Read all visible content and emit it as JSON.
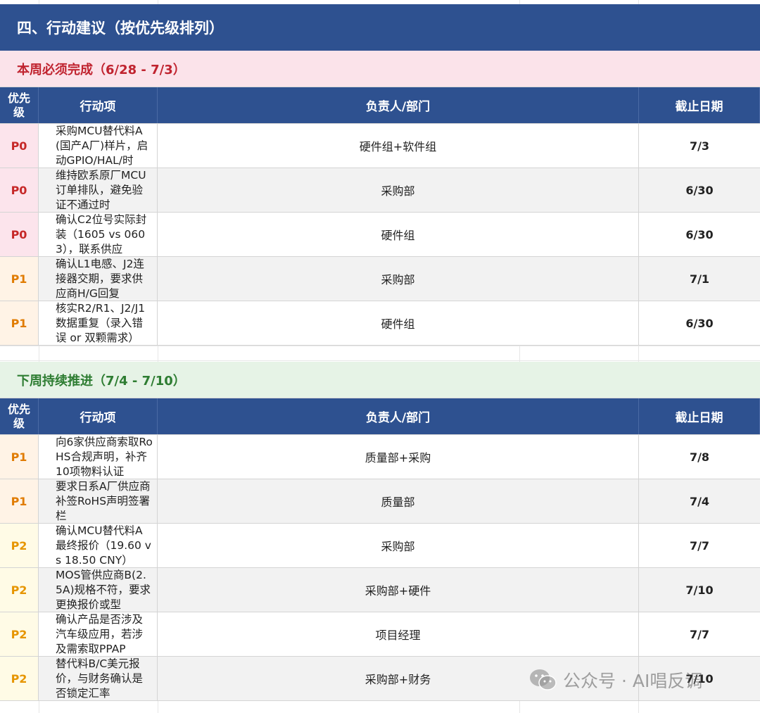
{
  "section": {
    "title": "四、行动建议（按优先级排列）"
  },
  "table_headers": {
    "priority": "优先级",
    "action": "行动项",
    "owner": "负责人/部门",
    "due": "截止日期"
  },
  "week1": {
    "title": "本周必须完成（6/28 - 7/3）",
    "rows": [
      {
        "priority": "P0",
        "action": "采购MCU替代料A(国产A厂)样片，启动GPIO/HAL/时",
        "owner": "硬件组+软件组",
        "due": "7/3"
      },
      {
        "priority": "P0",
        "action": "维持欧系原厂MCU订单排队，避免验证不通过时",
        "owner": "采购部",
        "due": "6/30"
      },
      {
        "priority": "P0",
        "action": "确认C2位号实际封装（1605 vs 0603），联系供应",
        "owner": "硬件组",
        "due": "6/30"
      },
      {
        "priority": "P1",
        "action": "确认L1电感、J2连接器交期，要求供应商H/G回复",
        "owner": "采购部",
        "due": "7/1"
      },
      {
        "priority": "P1",
        "action": "核实R2/R1、J2/J1数据重复（录入错误 or 双颗需求）",
        "owner": "硬件组",
        "due": "6/30"
      }
    ]
  },
  "week2": {
    "title": "下周持续推进（7/4 - 7/10）",
    "rows": [
      {
        "priority": "P1",
        "action": "向6家供应商索取RoHS合规声明，补齐10项物料认证",
        "owner": "质量部+采购",
        "due": "7/8"
      },
      {
        "priority": "P1",
        "action": "要求日系A厂供应商补签RoHS声明签署栏",
        "owner": "质量部",
        "due": "7/4"
      },
      {
        "priority": "P2",
        "action": "确认MCU替代料A最终报价（19.60 vs 18.50 CNY）",
        "owner": "采购部",
        "due": "7/7"
      },
      {
        "priority": "P2",
        "action": "MOS管供应商B(2.5A)规格不符，要求更换报价或型",
        "owner": "采购部+硬件",
        "due": "7/10"
      },
      {
        "priority": "P2",
        "action": "确认产品是否涉及汽车级应用，若涉及需索取PPAP",
        "owner": "项目经理",
        "due": "7/7"
      },
      {
        "priority": "P2",
        "action": "替代料B/C美元报价，与财务确认是否锁定汇率",
        "owner": "采购部+财务",
        "due": "7/10"
      }
    ]
  },
  "watermark": {
    "text": "公众号 · AI唱反调",
    "icon": "wechat-icon"
  },
  "colors": {
    "banner": "#2e5190",
    "p0": "#c62828",
    "p1": "#e07b00",
    "p2": "#e69500",
    "week1_title": "#c0232f",
    "week2_title": "#2e7d32"
  }
}
